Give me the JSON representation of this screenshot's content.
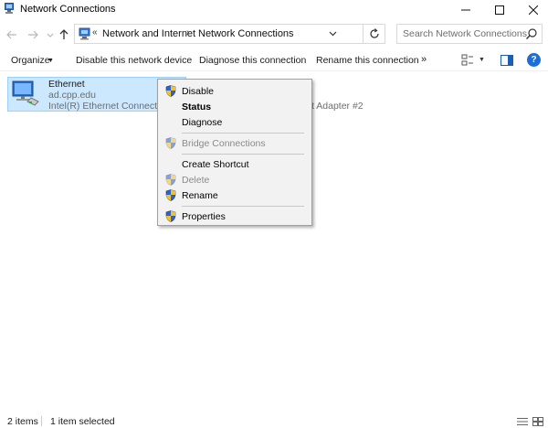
{
  "window": {
    "title": "Network Connections"
  },
  "address": {
    "prefix": "«",
    "crumbs": [
      "Network and Internet",
      "Network Connections"
    ],
    "separator": "›"
  },
  "search": {
    "placeholder": "Search Network Connections"
  },
  "commands": {
    "organize": "Organize",
    "disable": "Disable this network device",
    "diagnose": "Diagnose this connection",
    "rename": "Rename this connection",
    "more": "»"
  },
  "items": [
    {
      "name": "Ethernet",
      "domain": "ad.cpp.edu",
      "adapter": "Intel(R) Ethernet Connection"
    },
    {
      "adapter_partial": "t Adapter #2"
    }
  ],
  "context_menu": {
    "items": [
      {
        "label": "Disable",
        "shield": true,
        "bold": false,
        "disabled": false
      },
      {
        "label": "Status",
        "shield": false,
        "bold": true,
        "disabled": false
      },
      {
        "label": "Diagnose",
        "shield": false,
        "bold": false,
        "disabled": false
      },
      {
        "label": "Bridge Connections",
        "shield": true,
        "bold": false,
        "disabled": true
      },
      {
        "label": "Create Shortcut",
        "shield": false,
        "bold": false,
        "disabled": false
      },
      {
        "label": "Delete",
        "shield": true,
        "bold": false,
        "disabled": true
      },
      {
        "label": "Rename",
        "shield": true,
        "bold": false,
        "disabled": false
      },
      {
        "label": "Properties",
        "shield": true,
        "bold": false,
        "disabled": false
      }
    ]
  },
  "status": {
    "count": "2 items",
    "selected": "1 item selected"
  },
  "colors": {
    "selection_bg": "#cce8ff",
    "selection_border": "#99d1ff",
    "help_blue": "#1a6fd8"
  }
}
